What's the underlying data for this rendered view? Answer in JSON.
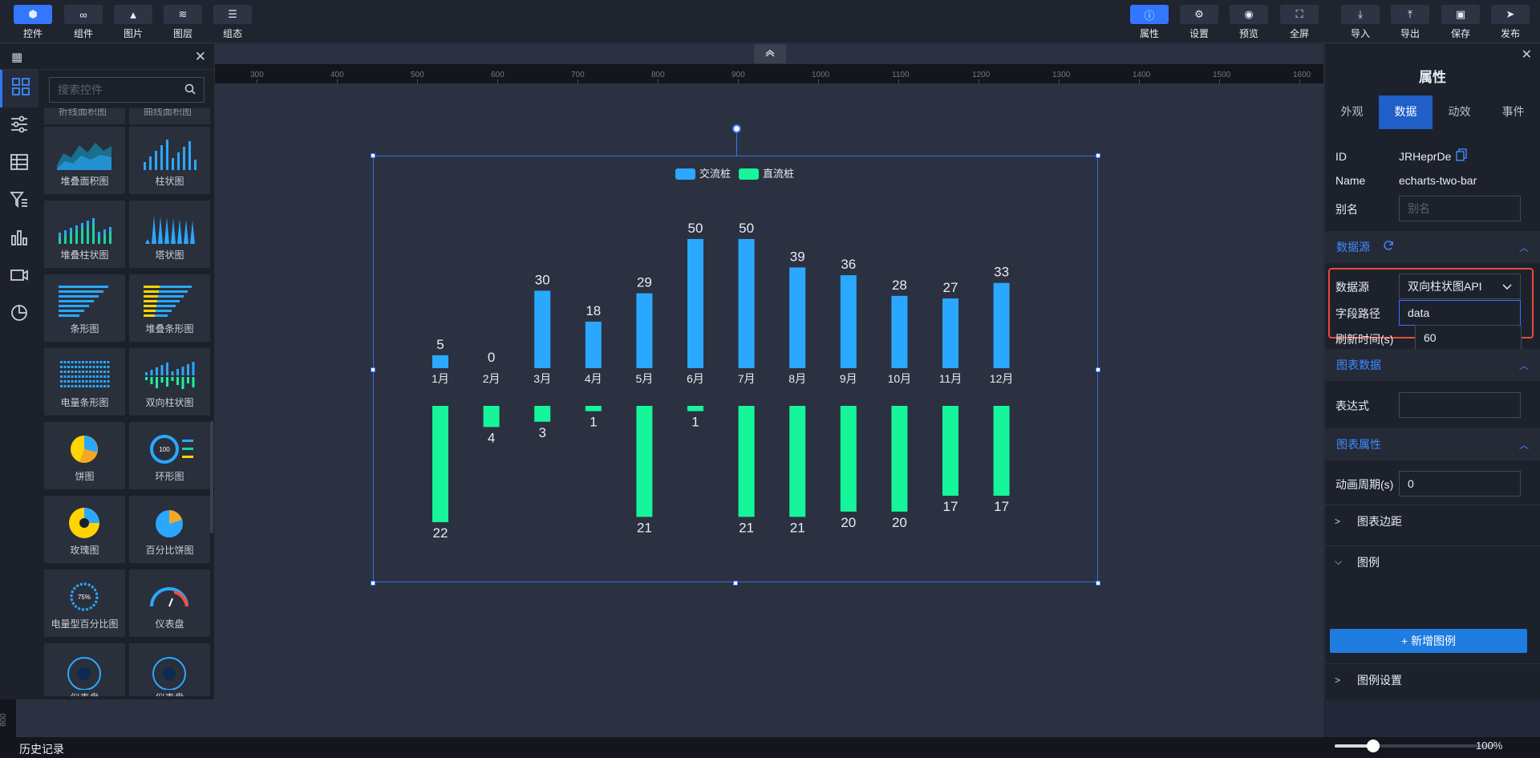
{
  "toolbar": {
    "left": [
      {
        "label": "控件",
        "icon": "cube-icon",
        "active": true
      },
      {
        "label": "组件",
        "icon": "link-icon",
        "active": false
      },
      {
        "label": "图片",
        "icon": "image-icon",
        "active": false
      },
      {
        "label": "图层",
        "icon": "layers-icon",
        "active": false
      },
      {
        "label": "组态",
        "icon": "menu-icon",
        "active": false
      }
    ],
    "right": [
      {
        "label": "属性",
        "icon": "info-icon",
        "active": true
      },
      {
        "label": "设置",
        "icon": "gear-icon",
        "active": false
      },
      {
        "label": "预览",
        "icon": "eye-icon",
        "active": false
      },
      {
        "label": "全屏",
        "icon": "fullscreen-icon",
        "active": false
      },
      {
        "label": "导入",
        "icon": "import-icon",
        "active": false
      },
      {
        "label": "导出",
        "icon": "export-icon",
        "active": false
      },
      {
        "label": "保存",
        "icon": "save-icon",
        "active": false
      },
      {
        "label": "发布",
        "icon": "send-icon",
        "active": false
      }
    ]
  },
  "widget_panel": {
    "search_placeholder": "搜索控件",
    "partial_labels": [
      "折线面积图",
      "曲线面积图"
    ],
    "widgets": [
      {
        "label": "堆叠面积图"
      },
      {
        "label": "柱状图"
      },
      {
        "label": "堆叠柱状图"
      },
      {
        "label": "塔状图"
      },
      {
        "label": "条形图"
      },
      {
        "label": "堆叠条形图"
      },
      {
        "label": "电量条形图"
      },
      {
        "label": "双向柱状图"
      },
      {
        "label": "饼图"
      },
      {
        "label": "环形图"
      },
      {
        "label": "玫瑰图"
      },
      {
        "label": "百分比饼图"
      },
      {
        "label": "电量型百分比图"
      },
      {
        "label": "仪表盘"
      },
      {
        "label": "仪表盘"
      },
      {
        "label": "仪表盘"
      }
    ],
    "thumb_texts": {
      "ring_value": "100",
      "gauge_percent": "75%"
    }
  },
  "ruler": {
    "ticks": [
      "300",
      "400",
      "500",
      "600",
      "700",
      "800",
      "900",
      "1000",
      "1100",
      "1200",
      "1300",
      "1400",
      "1500",
      "1600"
    ]
  },
  "vertical_ruler_label": "800",
  "chart_data": {
    "type": "bar",
    "categories": [
      "1月",
      "2月",
      "3月",
      "4月",
      "5月",
      "6月",
      "7月",
      "8月",
      "9月",
      "10月",
      "11月",
      "12月"
    ],
    "series": [
      {
        "name": "交流桩",
        "values": [
          5,
          0,
          30,
          18,
          29,
          50,
          50,
          39,
          36,
          28,
          27,
          33
        ],
        "color": "#2aa8ff",
        "direction": "up"
      },
      {
        "name": "直流桩",
        "values": [
          22,
          4,
          3,
          1,
          21,
          1,
          21,
          21,
          20,
          20,
          17,
          17
        ],
        "color": "#16f59a",
        "direction": "down"
      }
    ],
    "legend": "top-center"
  },
  "properties": {
    "title": "属性",
    "tabs": [
      {
        "label": "外观",
        "active": false
      },
      {
        "label": "数据",
        "active": true
      },
      {
        "label": "动效",
        "active": false
      },
      {
        "label": "事件",
        "active": false
      }
    ],
    "id_label": "ID",
    "id_value": "JRHeprDe",
    "name_label": "Name",
    "name_value": "echarts-two-bar",
    "alias_label": "别名",
    "alias_placeholder": "别名",
    "datasource_section": "数据源",
    "datasource_label": "数据源",
    "datasource_value": "双向柱状图API",
    "field_path_label": "字段路径",
    "field_path_value": "data",
    "refresh_label": "刷新时间(s)",
    "refresh_value": "60",
    "chartdata_section": "图表数据",
    "expression_label": "表达式",
    "expression_value": "",
    "chartprops_section": "图表属性",
    "anim_label": "动画周期(s)",
    "anim_value": "0",
    "margin_label": "图表边距",
    "legend_label": "图例",
    "add_legend_label": "+ 新增图例",
    "legend_settings_label": "图例设置"
  },
  "footer": {
    "history_label": "历史记录",
    "zoom_text": "100%",
    "zoom_fraction": 0.24
  },
  "colors": {
    "accent": "#3377ff",
    "highlight": "#e64b3c",
    "section_text": "#3e8bff"
  }
}
